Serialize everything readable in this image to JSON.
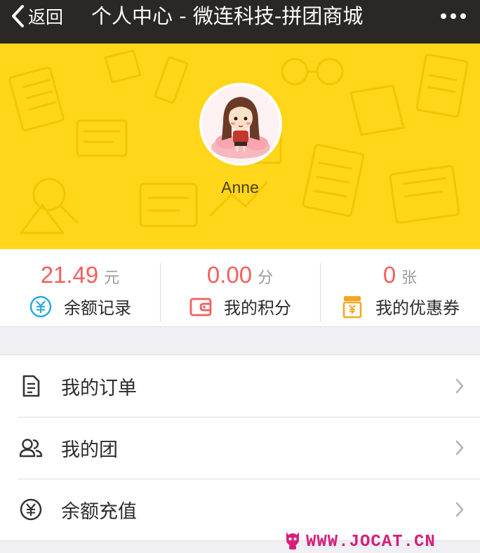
{
  "navbar": {
    "back_label": "返回",
    "title": "个人中心 - 微连科技-拼团商城",
    "back_icon": "chevron-left-icon",
    "more_icon": "more-dots-icon"
  },
  "profile": {
    "username": "Anne",
    "avatar_icon": "cartoon-girl-avatar",
    "background_color": "#ffd61a"
  },
  "stats": [
    {
      "value": "21.49",
      "unit": "元",
      "label": "余额记录",
      "icon": "yuan-circle-icon",
      "icon_color": "#27a9e1"
    },
    {
      "value": "0.00",
      "unit": "分",
      "label": "我的积分",
      "icon": "wallet-icon",
      "icon_color": "#f25f5c"
    },
    {
      "value": "0",
      "unit": "张",
      "label": "我的优惠券",
      "icon": "coupon-jar-icon",
      "icon_color": "#f5a623"
    }
  ],
  "menu": [
    {
      "label": "我的订单",
      "icon": "document-icon"
    },
    {
      "label": "我的团",
      "icon": "group-icon"
    },
    {
      "label": "余额充值",
      "icon": "yuan-circle-icon"
    }
  ],
  "watermark": {
    "text": "WWW.JOCAT.CN",
    "color": "#d61f7b"
  },
  "colors": {
    "accent_red": "#f25f5c",
    "navbar_bg": "#2a2724"
  }
}
